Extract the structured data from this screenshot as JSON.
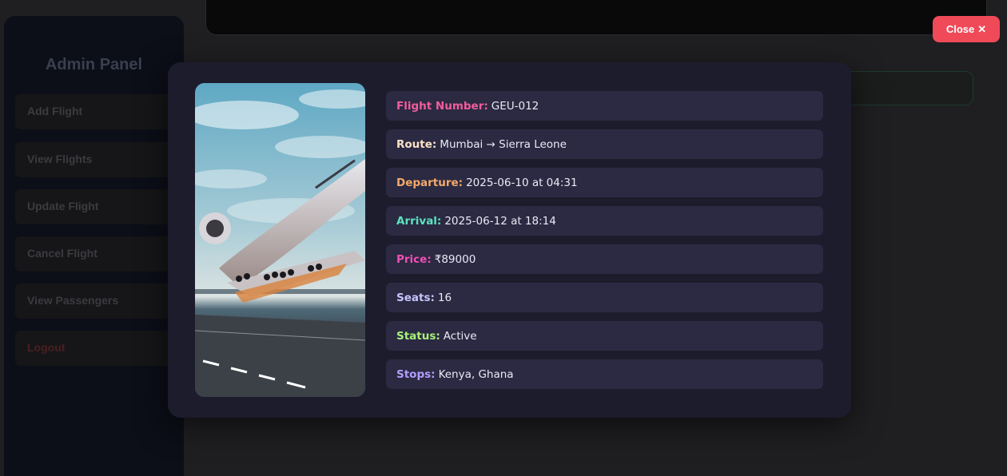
{
  "sidebar": {
    "title": "Admin Panel",
    "items": [
      {
        "label": "Add Flight"
      },
      {
        "label": "View Flights"
      },
      {
        "label": "Update Flight"
      },
      {
        "label": "Cancel Flight"
      },
      {
        "label": "View Passengers"
      },
      {
        "label": "Logout"
      }
    ]
  },
  "close_button": {
    "label": "Close",
    "icon": "✕"
  },
  "flight": {
    "image_icon": "airplane-takeoff-photo",
    "details": [
      {
        "label": "Flight Number:",
        "value": "GEU-012",
        "color": "#f25c9c"
      },
      {
        "label": "Route:",
        "value": "Mumbai → Sierra Leone",
        "color": "#fde1c8"
      },
      {
        "label": "Departure:",
        "value": "2025-06-10 at 04:31",
        "color": "#f4a96a"
      },
      {
        "label": "Arrival:",
        "value": "2025-06-12 at 18:14",
        "color": "#5ce3c0"
      },
      {
        "label": "Price:",
        "value": "₹89000",
        "color": "#f04fb4"
      },
      {
        "label": "Seats:",
        "value": "16",
        "color": "#c9c2ff"
      },
      {
        "label": "Status:",
        "value": "Active",
        "color": "#a8f07a"
      },
      {
        "label": "Stops:",
        "value": "Kenya, Ghana",
        "color": "#b39cff"
      }
    ]
  }
}
